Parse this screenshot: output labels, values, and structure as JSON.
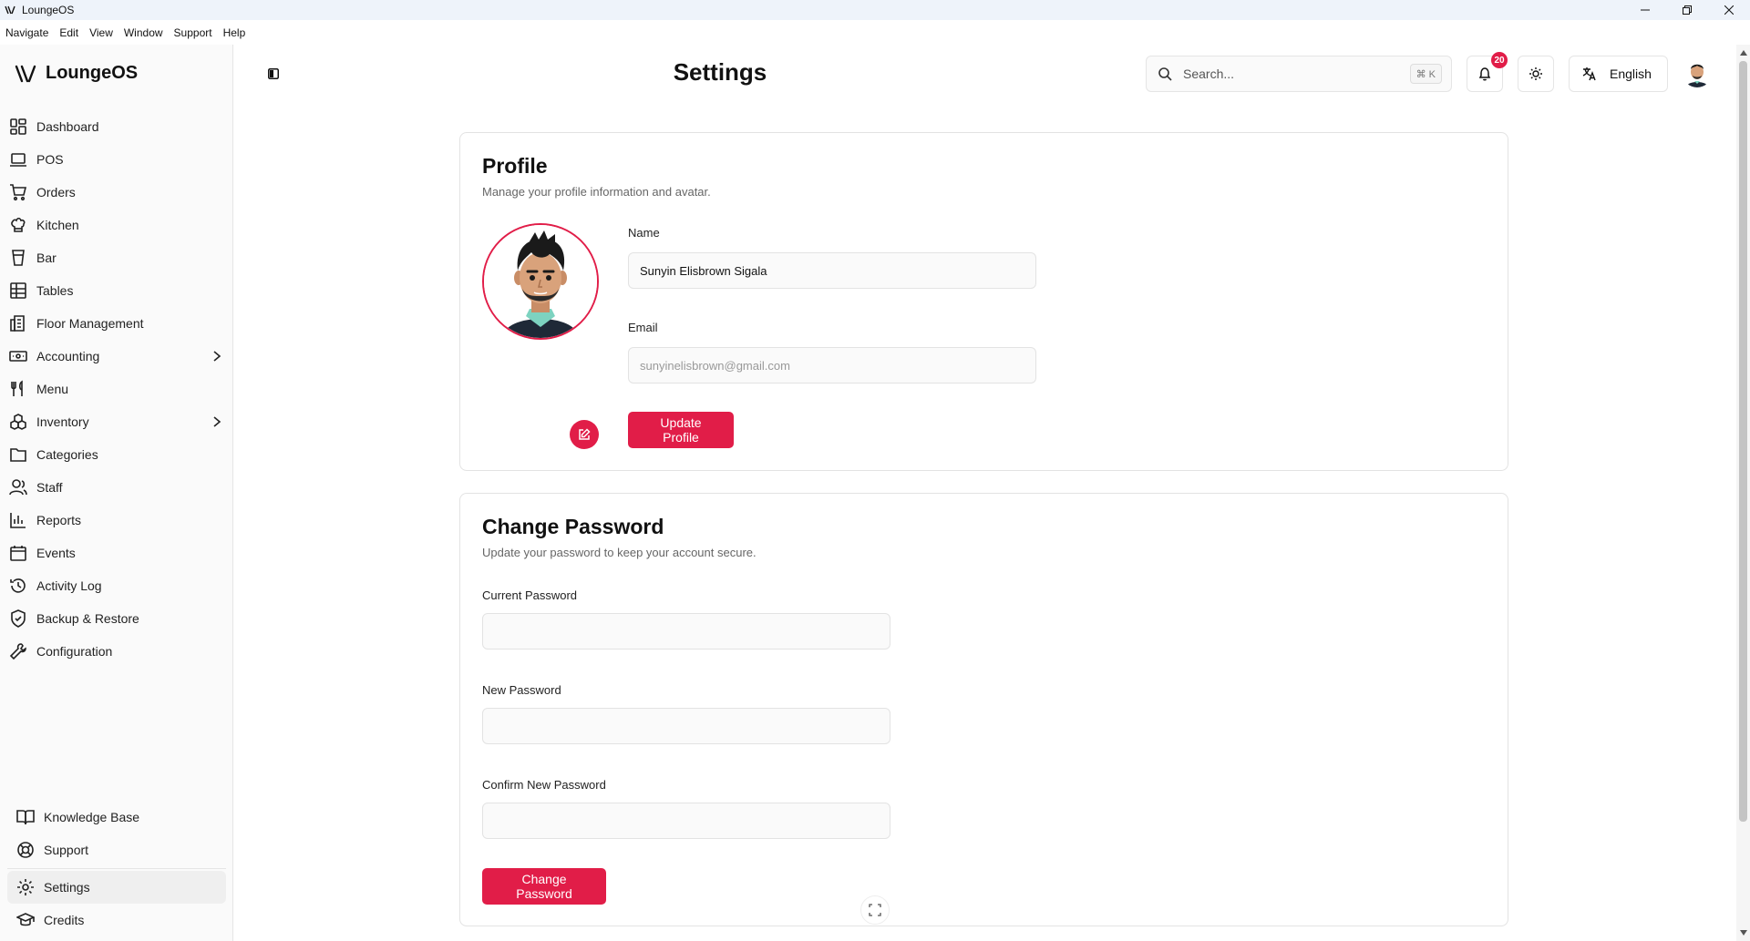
{
  "window": {
    "title": "LoungeOS",
    "controls": [
      "minimize-icon",
      "restore-icon",
      "close-icon"
    ]
  },
  "menubar": {
    "items": [
      "Navigate",
      "Edit",
      "View",
      "Window",
      "Support",
      "Help"
    ]
  },
  "sidebar": {
    "brand": "LoungeOS",
    "items": [
      {
        "label": "Dashboard",
        "icon": "dashboard-icon"
      },
      {
        "label": "POS",
        "icon": "laptop-icon"
      },
      {
        "label": "Orders",
        "icon": "cart-icon"
      },
      {
        "label": "Kitchen",
        "icon": "chef-hat-icon"
      },
      {
        "label": "Bar",
        "icon": "cup-icon"
      },
      {
        "label": "Tables",
        "icon": "table-icon"
      },
      {
        "label": "Floor Management",
        "icon": "floor-icon"
      },
      {
        "label": "Accounting",
        "icon": "banknote-icon",
        "expandable": true
      },
      {
        "label": "Menu",
        "icon": "utensils-icon"
      },
      {
        "label": "Inventory",
        "icon": "boxes-icon",
        "expandable": true
      },
      {
        "label": "Categories",
        "icon": "folder-icon"
      },
      {
        "label": "Staff",
        "icon": "users-icon"
      },
      {
        "label": "Reports",
        "icon": "bar-chart-icon"
      },
      {
        "label": "Events",
        "icon": "calendar-icon"
      },
      {
        "label": "Activity Log",
        "icon": "history-icon"
      },
      {
        "label": "Backup & Restore",
        "icon": "shield-check-icon"
      },
      {
        "label": "Configuration",
        "icon": "wrench-icon"
      }
    ],
    "bottom_items": [
      {
        "label": "Knowledge Base",
        "icon": "book-icon"
      },
      {
        "label": "Support",
        "icon": "lifebuoy-icon"
      },
      {
        "label": "Settings",
        "icon": "gear-icon",
        "active": true
      },
      {
        "label": "Credits",
        "icon": "graduation-cap-icon"
      }
    ]
  },
  "header": {
    "title": "Settings",
    "search_placeholder": "Search...",
    "search_shortcut": "⌘ K",
    "notification_count": "20",
    "language": "English"
  },
  "profile": {
    "title": "Profile",
    "description": "Manage your profile information and avatar.",
    "name_label": "Name",
    "name_value": "Sunyin Elisbrown Sigala",
    "email_label": "Email",
    "email_placeholder": "sunyinelisbrown@gmail.com",
    "submit_label": "Update Profile"
  },
  "password": {
    "title": "Change Password",
    "description": "Update your password to keep your account secure.",
    "current_label": "Current Password",
    "new_label": "New Password",
    "confirm_label": "Confirm New Password",
    "submit_label": "Change Password"
  },
  "colors": {
    "accent": "#e11d48",
    "sidebar_bg": "#fafafa",
    "border": "#e3e3e3"
  }
}
